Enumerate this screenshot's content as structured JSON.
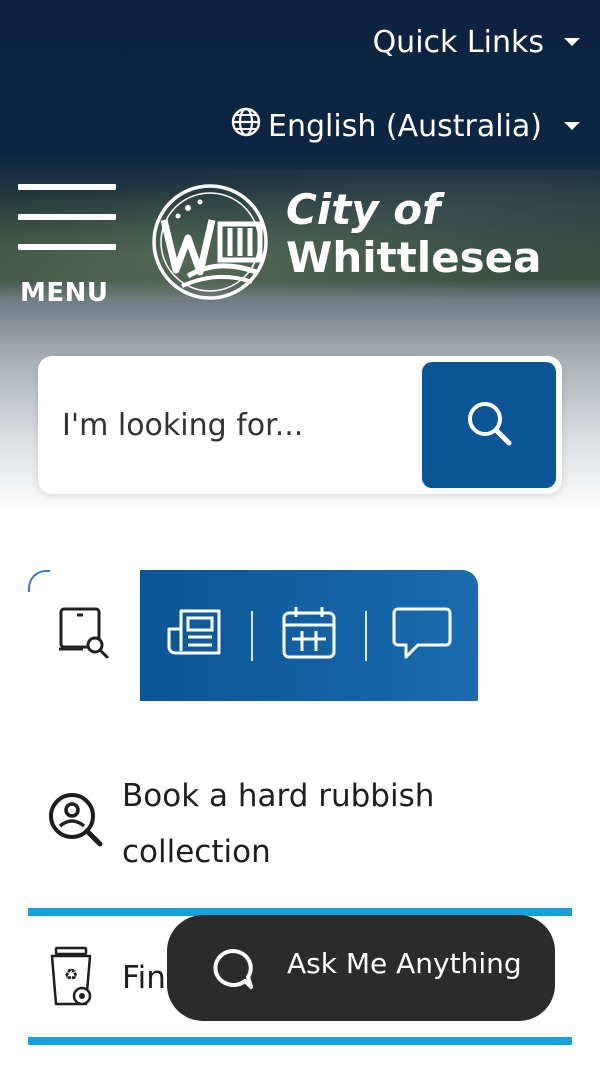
{
  "header": {
    "quick_links_label": "Quick Links",
    "language_label": "English (Australia)",
    "menu_label": "MENU",
    "logo": {
      "line1": "City of",
      "line2": "Whittlesea"
    }
  },
  "search": {
    "placeholder": "I'm looking for...",
    "value": ""
  },
  "tabs": [
    {
      "icon": "device-search-icon",
      "selected": true
    },
    {
      "icon": "newspaper-icon",
      "selected": false
    },
    {
      "icon": "calendar-icon",
      "selected": false
    },
    {
      "icon": "chat-bubble-icon",
      "selected": false
    }
  ],
  "quick_items": [
    {
      "icon": "person-search-icon",
      "label_line1": "Book a hard rubbish",
      "label_line2": "collection"
    },
    {
      "icon": "recycle-bin-icon",
      "label_line1": "Fin"
    }
  ],
  "chat_widget": {
    "label": "Ask Me Anything"
  },
  "colors": {
    "header_navy": "#0c2440",
    "primary_blue": "#0a5594",
    "divider_cyan": "#16a0dc",
    "chat_dark": "#2b2b2b"
  }
}
